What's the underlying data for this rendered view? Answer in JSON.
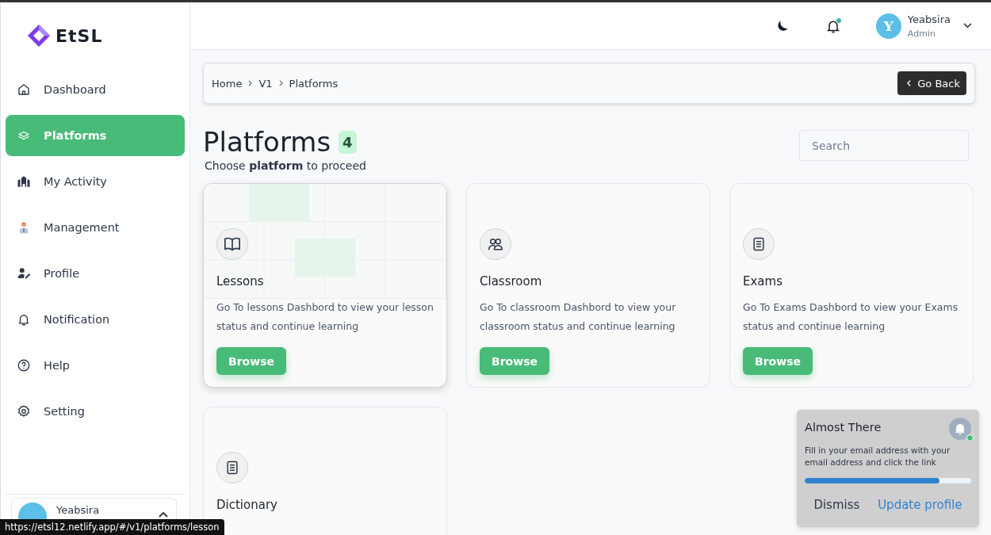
{
  "sidebar": {
    "logo": "EtSL",
    "items": [
      {
        "label": "Dashboard",
        "selected": false
      },
      {
        "label": "Platforms",
        "selected": true
      },
      {
        "label": "My Activity",
        "selected": false
      },
      {
        "label": "Management",
        "selected": false
      },
      {
        "label": "Profile",
        "selected": false
      },
      {
        "label": "Notification",
        "selected": false
      },
      {
        "label": "Help",
        "selected": false
      },
      {
        "label": "Setting",
        "selected": false
      }
    ],
    "user": {
      "name": "Yeabsira"
    }
  },
  "header": {
    "notification_dot": true,
    "user": {
      "initial": "Y",
      "name": "Yeabsira",
      "role": "Admin"
    }
  },
  "breadcrumb": {
    "items": [
      "Home",
      "V1",
      "Platforms"
    ],
    "back_button": "Go Back"
  },
  "page": {
    "title": "Platforms",
    "count": "4",
    "subtitle": "Choose **platform** to proceed",
    "search": {
      "placeholder": "Search"
    }
  },
  "cards": [
    {
      "title": "Lessons",
      "description": "Go To lessons Dashbord to view your lesson status and continue learning",
      "button": "Browse",
      "hovered": true
    },
    {
      "title": "Classroom",
      "description": "Go To classroom Dashbord to view your classroom status and continue learning",
      "button": "Browse",
      "hovered": false
    },
    {
      "title": "Exams",
      "description": "Go To Exams Dashbord to view your Exams status and continue learning",
      "button": "Browse",
      "hovered": false
    },
    {
      "title": "Dictionary",
      "hovered": false
    }
  ],
  "toast": {
    "title": "Almost There",
    "message": "Fill in your email address with your email address and click the link",
    "level": 0.81,
    "dismiss": "Dismiss",
    "action": "Update profile"
  },
  "status_url": "https://etsl12.netlify.app/#/v1/platforms/lesson"
}
